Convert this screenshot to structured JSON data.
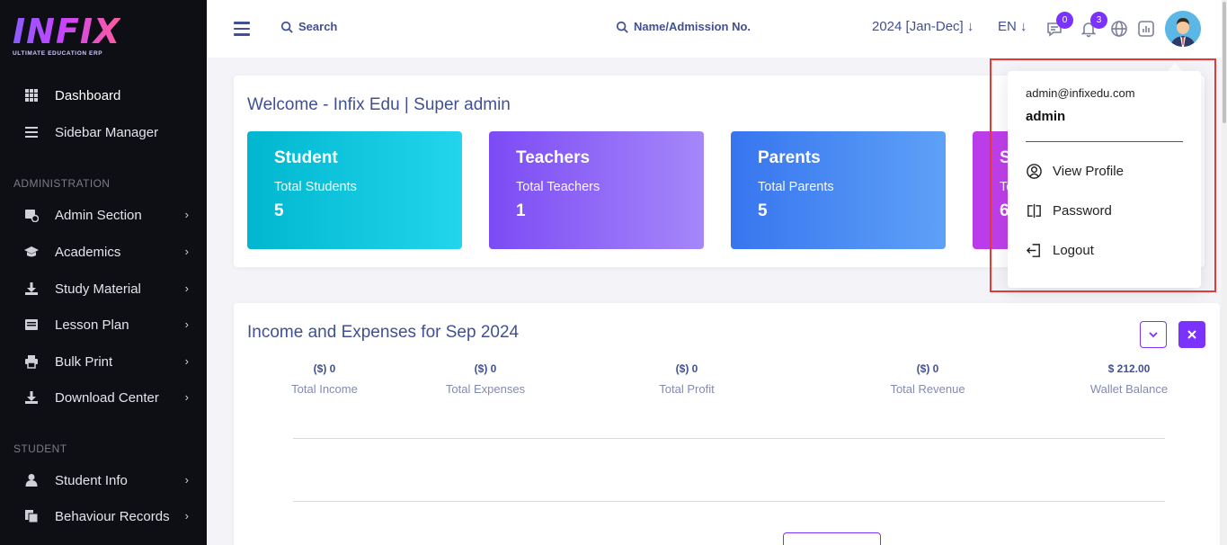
{
  "brand": {
    "name": "INFIX",
    "tagline": "ULTIMATE EDUCATION ERP"
  },
  "sidebar": {
    "items": [
      {
        "label": "Dashboard",
        "icon": "grid-icon"
      },
      {
        "label": "Sidebar Manager",
        "icon": "list-icon"
      }
    ],
    "section_admin": "ADMINISTRATION",
    "admin_items": [
      {
        "label": "Admin Section",
        "icon": "admin-icon"
      },
      {
        "label": "Academics",
        "icon": "graduation-cap-icon"
      },
      {
        "label": "Study Material",
        "icon": "download-icon"
      },
      {
        "label": "Lesson Plan",
        "icon": "lesson-icon"
      },
      {
        "label": "Bulk Print",
        "icon": "printer-icon"
      },
      {
        "label": "Download Center",
        "icon": "download-icon"
      }
    ],
    "section_student": "STUDENT",
    "student_items": [
      {
        "label": "Student Info",
        "icon": "user-icon"
      },
      {
        "label": "Behaviour Records",
        "icon": "records-icon"
      }
    ]
  },
  "header": {
    "search_label": "Search",
    "admission_search_label": "Name/Admission No.",
    "year": "2024 [Jan-Dec]",
    "language": "EN",
    "messages_count": "0",
    "notifications_count": "3"
  },
  "welcome": {
    "title": "Welcome - Infix Edu | Super admin",
    "cards": [
      {
        "title": "Student",
        "subtitle": "Total Students",
        "value": "5",
        "color": "#1fc5e0"
      },
      {
        "title": "Teachers",
        "subtitle": "Total Teachers",
        "value": "1",
        "color": "#8d5cf6"
      },
      {
        "title": "Parents",
        "subtitle": "Total Parents",
        "value": "5",
        "color": "#3f7ff0"
      },
      {
        "title": "S",
        "subtitle": "To",
        "value": "6",
        "color": "#c03ee8"
      }
    ]
  },
  "income": {
    "title": "Income and Expenses for Sep 2024",
    "metrics": [
      {
        "value": "($) 0",
        "label": "Total Income"
      },
      {
        "value": "($) 0",
        "label": "Total Expenses"
      },
      {
        "value": "($) 0",
        "label": "Total Profit"
      },
      {
        "value": "($) 0",
        "label": "Total Revenue"
      },
      {
        "value": "$ 212.00",
        "label": "Wallet Balance"
      }
    ]
  },
  "profile_menu": {
    "email": "admin@infixedu.com",
    "name": "admin",
    "items": [
      {
        "label": "View Profile",
        "icon": "user-circle-icon"
      },
      {
        "label": "Password",
        "icon": "key-icon"
      },
      {
        "label": "Logout",
        "icon": "logout-icon"
      }
    ]
  },
  "colors": {
    "accent": "#7c32ff",
    "text": "#415094",
    "highlight": "#e53935"
  }
}
